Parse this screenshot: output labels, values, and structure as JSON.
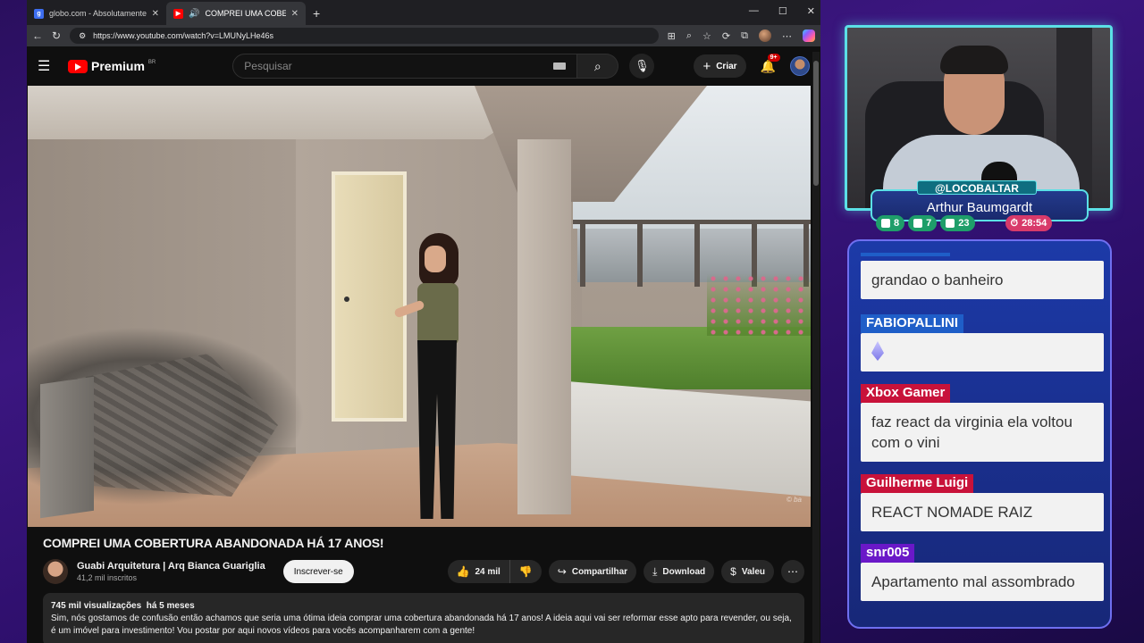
{
  "browser": {
    "tabs": [
      {
        "favicon": "g",
        "title": "globo.com - Absolutamente tudo",
        "active": false
      },
      {
        "favicon": "yt",
        "title": "COMPREI UMA COBERTURA",
        "active": true
      }
    ],
    "url": "https://www.youtube.com/watch?v=LMUNyLHe46s"
  },
  "youtube": {
    "logo_text": "Premium",
    "logo_region": "BR",
    "search_placeholder": "Pesquisar",
    "create_label": "Criar",
    "notifications_badge": "9+",
    "video": {
      "watermark": "© ba",
      "title": "COMPREI UMA COBERTURA ABANDONADA HÁ 17 ANOS!",
      "channel_name": "Guabi Arquitetura | Arq Bianca Guariglia",
      "subscribers": "41,2 mil inscritos",
      "subscribe_label": "Inscrever-se",
      "likes": "24 mil",
      "share_label": "Compartilhar",
      "download_label": "Download",
      "thanks_label": "Valeu",
      "views": "745 mil visualizações",
      "age": "há 5 meses",
      "description": "Sim, nós gostamos de confusão então achamos que seria uma ótima ideia comprar uma cobertura abandonada há 17 anos! A ideia aqui vai ser reformar esse apto para revender, ou seja, é um imóvel para investimento! Vou postar por aqui novos vídeos para vocês acompanharem com a gente!"
    }
  },
  "stream": {
    "handle": "@LOCOBALTAR",
    "name": "Arthur Baumgardt",
    "stats": [
      {
        "icon": "twitch-icon",
        "value": "8"
      },
      {
        "icon": "youtube-icon",
        "value": "7"
      },
      {
        "icon": "kick-icon",
        "value": "23"
      }
    ],
    "timer": "28:54",
    "chat": [
      {
        "author": "",
        "text": "grandao o banheiro",
        "color": "#1f5ec8"
      },
      {
        "author": "FABIOPALLINI",
        "text": "",
        "emote": "gem-emote",
        "color": "#1f5ec8"
      },
      {
        "author": "Xbox Gamer",
        "text": "faz react da virginia ela voltou com o vini",
        "color": "#c8123a"
      },
      {
        "author": "Guilherme Luigi",
        "text": "REACT NOMADE RAIZ",
        "color": "#c8123a"
      },
      {
        "author": "snr005",
        "text": "Apartamento mal assombrado",
        "color": "#6a18c8"
      }
    ]
  }
}
